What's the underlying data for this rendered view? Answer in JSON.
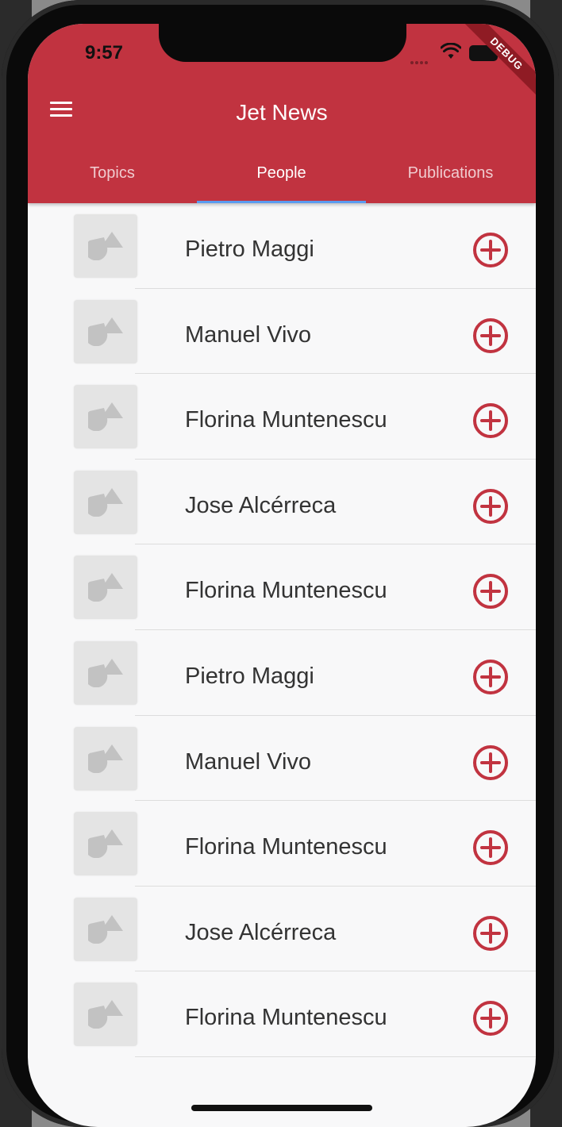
{
  "status_bar": {
    "time": "9:57"
  },
  "debug_banner": "DEBUG",
  "app_bar": {
    "title": "Jet News",
    "menu_icon": "hamburger-menu-icon"
  },
  "tabs": [
    {
      "label": "Topics",
      "active": false
    },
    {
      "label": "People",
      "active": true
    },
    {
      "label": "Publications",
      "active": false
    }
  ],
  "people": [
    {
      "name": "Pietro Maggi"
    },
    {
      "name": "Manuel Vivo"
    },
    {
      "name": "Florina Muntenescu"
    },
    {
      "name": "Jose Alcérreca"
    },
    {
      "name": "Florina Muntenescu"
    },
    {
      "name": "Pietro Maggi"
    },
    {
      "name": "Manuel Vivo"
    },
    {
      "name": "Florina Muntenescu"
    },
    {
      "name": "Jose Alcérreca"
    },
    {
      "name": "Florina Muntenescu"
    }
  ],
  "colors": {
    "app_bar": "#c13340",
    "accent": "#c13340",
    "tab_indicator": "#5b9bf0",
    "background": "#f8f8f9"
  },
  "icons": {
    "follow": "add-circle-outline-icon",
    "thumbnail": "image-placeholder-icon"
  }
}
